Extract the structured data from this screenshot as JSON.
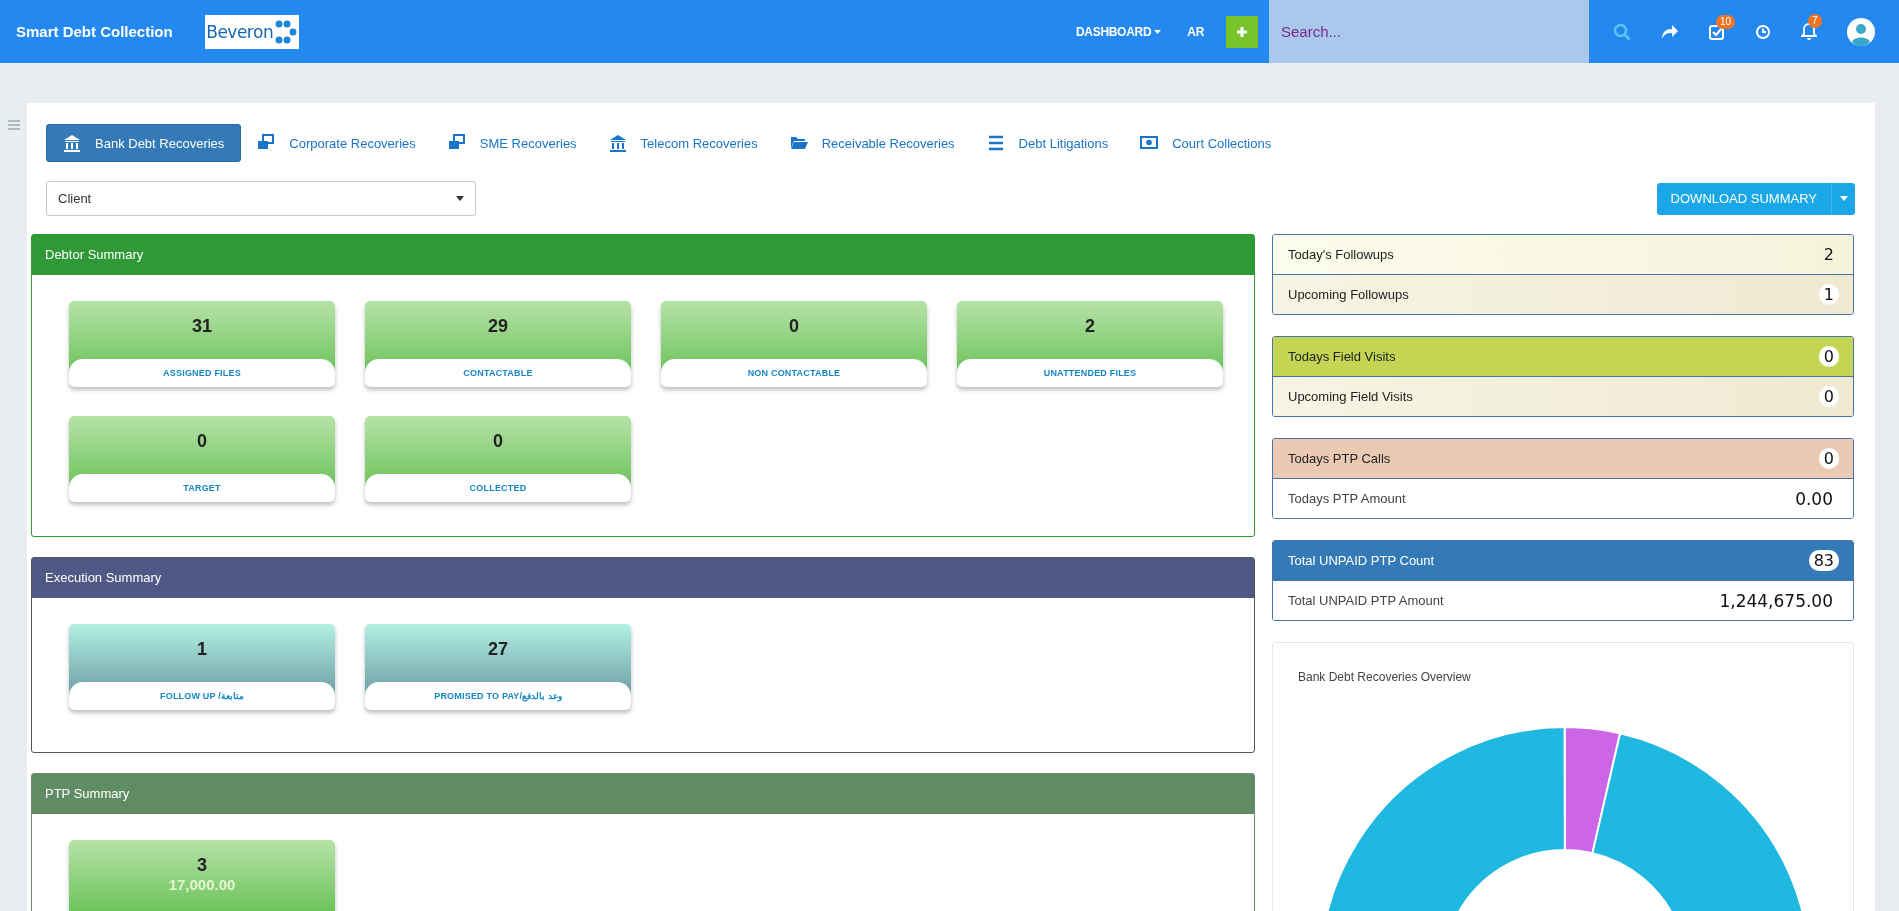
{
  "header": {
    "title": "Smart Debt Collection",
    "logo_text": "Beveron",
    "nav": [
      {
        "label": "DASHBOARD",
        "kind": "dropdown"
      },
      {
        "label": "AR",
        "kind": "link"
      }
    ],
    "search": {
      "placeholder": "Search..."
    },
    "tasks_badge": "10",
    "notifications_badge": "7"
  },
  "tabs": [
    {
      "label": "Bank Debt Recoveries",
      "selected": true
    },
    {
      "label": "Corporate Recoveries",
      "selected": false
    },
    {
      "label": "SME Recoveries",
      "selected": false
    },
    {
      "label": "Telecom Recoveries",
      "selected": false
    },
    {
      "label": "Receivable Recoveries",
      "selected": false
    },
    {
      "label": "Debt Litigations",
      "selected": false
    },
    {
      "label": "Court Collections",
      "selected": false
    }
  ],
  "client_select": {
    "value": "Client"
  },
  "download_button": {
    "label": "DOWNLOAD SUMMARY"
  },
  "panels": [
    {
      "title": "Debtor Summary",
      "kind": "debtor",
      "cards": [
        {
          "value": "31",
          "label": "ASSIGNED FILES"
        },
        {
          "value": "29",
          "label": "CONTACTABLE"
        },
        {
          "value": "0",
          "label": "NON CONTACTABLE"
        },
        {
          "value": "2",
          "label": "UNATTENDED FILES"
        },
        {
          "value": "0",
          "label": "TARGET"
        },
        {
          "value": "0",
          "label": "COLLECTED"
        }
      ]
    },
    {
      "title": "Execution Summary",
      "kind": "execution",
      "cards": [
        {
          "value": "1",
          "label": "FOLLOW UP /متابعة"
        },
        {
          "value": "27",
          "label": "PROMISED TO PAY/وعد بالدفع"
        }
      ]
    },
    {
      "title": "PTP Summary",
      "kind": "ptp",
      "cards": [
        {
          "value": "3",
          "amount": "17,000.00"
        }
      ]
    }
  ],
  "counter_groups": [
    {
      "rows": [
        {
          "label": "Today's Followups",
          "value": "2",
          "kind": "cream"
        },
        {
          "label": "Upcoming Followups",
          "value": "1",
          "kind": "sand"
        }
      ]
    },
    {
      "rows": [
        {
          "label": "Todays Field Visits",
          "value": "0",
          "kind": "lime"
        },
        {
          "label": "Upcoming Field Visits",
          "value": "0",
          "kind": "sand"
        }
      ]
    },
    {
      "rows": [
        {
          "label": "Todays PTP Calls",
          "value": "0",
          "kind": "peach"
        },
        {
          "label": "Todays PTP Amount",
          "value": "0.00",
          "kind": "plain"
        }
      ]
    },
    {
      "rows": [
        {
          "label": "Total UNPAID PTP Count",
          "value": "83",
          "kind": "blue"
        },
        {
          "label": "Total UNPAID PTP Amount",
          "value": "1,244,675.00",
          "kind": "plain"
        }
      ]
    }
  ],
  "overview": {
    "title": "Bank Debt Recoveries Overview"
  }
}
